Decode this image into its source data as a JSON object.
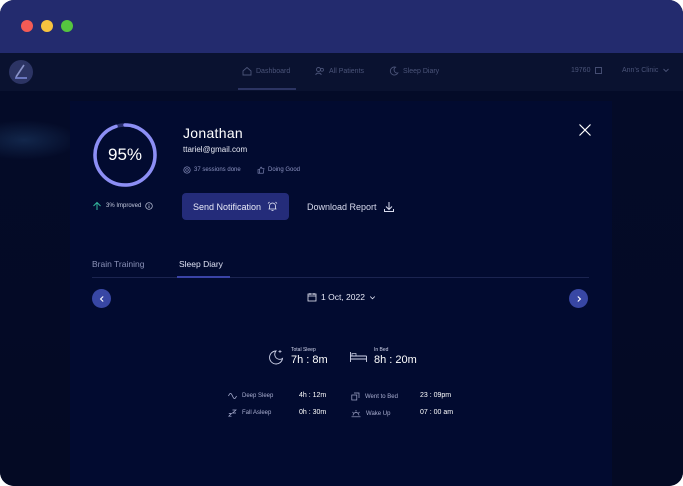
{
  "nav": {
    "dashboard": "Dashboard",
    "all_patients": "All Patients",
    "sleep_diary": "Sleep Diary",
    "count": "19760",
    "clinic": "Ann's Clinic"
  },
  "patient": {
    "score": "95%",
    "score_fraction": 0.95,
    "improved": "3% Improved",
    "name": "Jonathan",
    "email": "ttariel@gmail.com",
    "sessions": "37 sessions done",
    "status": "Doing Good"
  },
  "actions": {
    "notify": "Send Notification",
    "download": "Download Report"
  },
  "tabs": {
    "brain": "Brain Training",
    "sleep": "Sleep Diary"
  },
  "date": "1 Oct, 2022",
  "summary": {
    "total_label": "Total Sleep",
    "total_value": "7h : 8m",
    "bed_label": "In Bed",
    "bed_value": "8h : 20m"
  },
  "details": {
    "deep_label": "Deep Sleep",
    "deep_value": "4h : 12m",
    "fall_label": "Fall Asleep",
    "fall_value": "0h : 30m",
    "went_label": "Went to Bed",
    "went_value": "23 : 09pm",
    "wake_label": "Wake Up",
    "wake_value": "07 : 00 am"
  },
  "colors": {
    "titlebar": "#232b6e",
    "modal_bg": "#020b30",
    "accent": "#242c7a",
    "ring": "#8d8ff5",
    "improve_arrow": "#34b69c"
  }
}
